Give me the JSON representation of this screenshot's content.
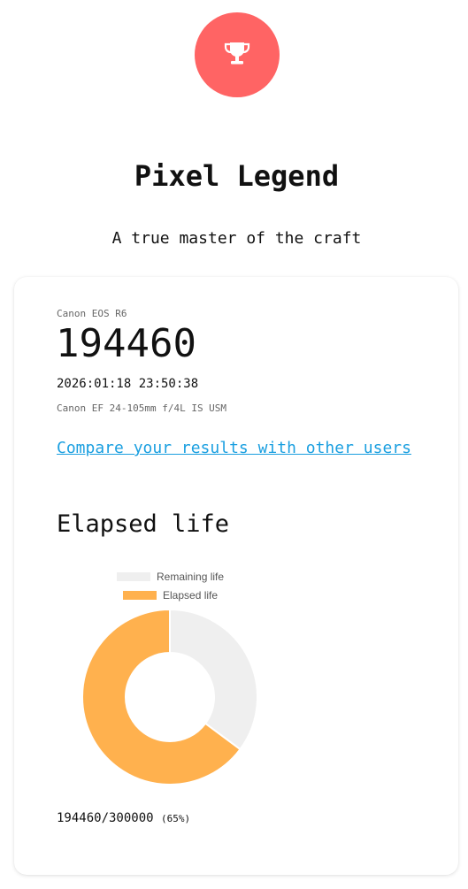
{
  "header": {
    "badge_icon": "trophy-icon",
    "badge_color": "#ff6464",
    "title": "Pixel Legend",
    "subtitle": "A true master of the craft"
  },
  "shutter": {
    "camera": "Canon EOS R6",
    "count": "194460",
    "datetime": "2026:01:18 23:50:38",
    "lens": "Canon EF 24-105mm f/4L IS USM",
    "compare_link": "Compare your results with other users"
  },
  "life_section": {
    "title": "Elapsed life",
    "summary_value": "194460/300000",
    "summary_percent": "(65%)"
  },
  "chart_data": {
    "type": "pie",
    "donut": true,
    "legend_position": "top",
    "series": [
      {
        "name": "Remaining life",
        "value": 105540,
        "color": "#efefef"
      },
      {
        "name": "Elapsed life",
        "value": 194460,
        "color": "#ffb14e"
      }
    ]
  }
}
